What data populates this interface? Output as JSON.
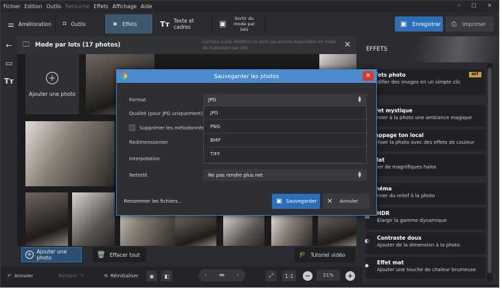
{
  "menu": [
    "Fichier",
    "Edition",
    "Outils",
    "Retouche",
    "Effets",
    "Affichage",
    "Aide"
  ],
  "toolbar": {
    "tabs": [
      "Amélioration",
      "Outils",
      "Effets",
      "Texte et cadres",
      "Sortir du mode par lots"
    ],
    "save": "Enregistrer",
    "print": "Imprimer"
  },
  "batch": {
    "title": "Mode par lots (17 photos)",
    "note": "Certains outils d'édition ne sont pas encore disponibles en mode de traitement par lots",
    "add_photo": "Ajouter une photo"
  },
  "bottom": {
    "add_photo": "Ajouter une photo",
    "clear": "Effacer tout",
    "tutorial": "Tutoriel vidéo"
  },
  "status": {
    "undo": "Annuler",
    "redo": "Rétablir",
    "reset": "Réinitialiser",
    "zoom_fit": "1:1",
    "zoom": "21%"
  },
  "dialog": {
    "title": "Sauvegarder les photos",
    "format_label": "Format",
    "format_value": "JPG",
    "quality_label": "Qualité (pour JPG uniquement)",
    "strip_meta": "Supprimer les métadonnées",
    "resize_label": "Redimensionner",
    "interp_label": "Interpolation",
    "sharp_label": "Netteté",
    "sharp_value": "Ne pas rendre plus net",
    "options": [
      "JPG",
      "PNG",
      "BMP",
      "TIFF"
    ],
    "rename": "Renommer les fichiers...",
    "save": "Sauvegarder",
    "cancel": "Annuler"
  },
  "effects": {
    "header": "EFFETS",
    "hit": "HIT",
    "items": [
      {
        "title": "Effets photo",
        "desc": "Modifier des images en un simple clic"
      },
      {
        "title": "Effet mystique",
        "desc": "Donner à la photo une ambiance magique"
      },
      {
        "title": "Mappage ton local",
        "desc": "Styliser la photo avec des effets de couleur"
      },
      {
        "title": "Éclat",
        "desc": "Créer de magnifiques halos"
      },
      {
        "title": "Cinéma",
        "desc": "Donner du relief à la photo"
      },
      {
        "title": "HDR",
        "desc": "Elargir la gamme dynamique"
      },
      {
        "title": "Contraste doux",
        "desc": "Ajouter de la dimension à la photo"
      },
      {
        "title": "Effet mat",
        "desc": "Ajouter une touche de chaleur brumeuse"
      }
    ]
  }
}
